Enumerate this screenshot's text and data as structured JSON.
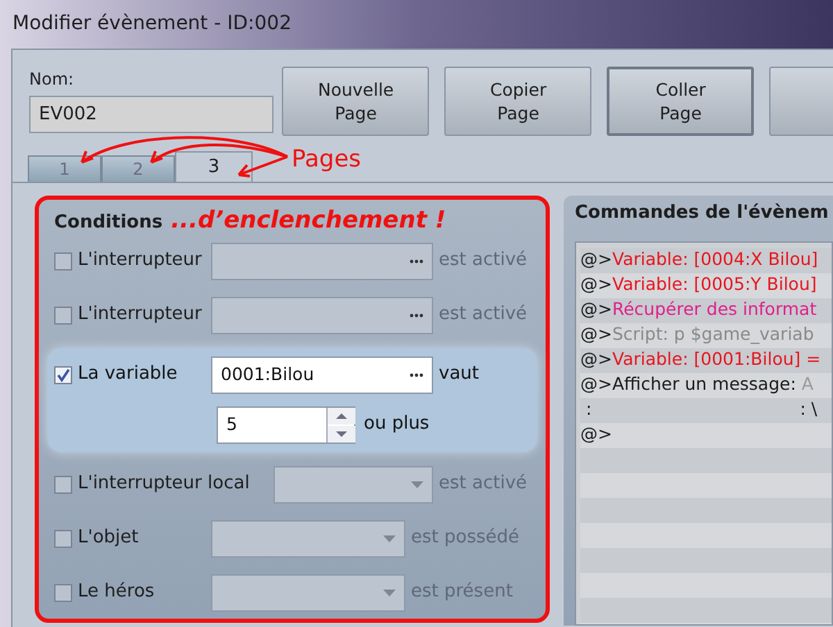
{
  "window": {
    "title": "Modifier évènement - ID:002"
  },
  "name_field": {
    "label": "Nom:",
    "value": "EV002"
  },
  "buttons": [
    {
      "label": "Nouvelle\nPage",
      "pressed": false
    },
    {
      "label": "Copier\nPage",
      "pressed": false
    },
    {
      "label": "Coller\nPage",
      "pressed": true
    },
    {
      "pressed": false
    }
  ],
  "tabs": [
    {
      "label": "1",
      "selected": false
    },
    {
      "label": "2",
      "selected": false
    },
    {
      "label": "3",
      "selected": true
    }
  ],
  "annotation": {
    "label": "Pages"
  },
  "conditions": {
    "title": "Conditions",
    "annotation": "...d’enclenchement !",
    "rows": [
      {
        "kind": "picker",
        "label": "L'interrupteur",
        "checked": false,
        "suffix": "est activé"
      },
      {
        "kind": "picker",
        "label": "L'interrupteur",
        "checked": false,
        "suffix": "est activé"
      },
      {
        "kind": "variable",
        "label": "La variable",
        "checked": true,
        "value": "0001:Bilou",
        "suffix": "vaut",
        "number": "5",
        "number_suffix": "ou plus"
      },
      {
        "kind": "dropdown_wide",
        "label": "L'interrupteur local",
        "checked": false,
        "suffix": "est activé"
      },
      {
        "kind": "dropdown",
        "label": "L'objet",
        "checked": false,
        "suffix": "est possédé"
      },
      {
        "kind": "dropdown",
        "label": "Le héros",
        "checked": false,
        "suffix": "est présent"
      }
    ]
  },
  "commands": {
    "title": "Commandes de l'évènem",
    "lines": [
      {
        "prefix": "@>",
        "segments": [
          {
            "text": "Variable: [0004:X Bilou]",
            "color": "#e8141e"
          }
        ]
      },
      {
        "prefix": "@>",
        "segments": [
          {
            "text": "Variable: [0005:Y Bilou]",
            "color": "#e8141e"
          }
        ]
      },
      {
        "prefix": "@>",
        "segments": [
          {
            "text": "Récupérer des informat",
            "color": "#e0208c"
          }
        ]
      },
      {
        "prefix": "@>",
        "segments": [
          {
            "text": "Script: p $game_variab",
            "color": "#8a8a8a"
          }
        ]
      },
      {
        "prefix": "@>",
        "segments": [
          {
            "text": "Variable: [0001:Bilou] =",
            "color": "#e8141e"
          }
        ]
      },
      {
        "prefix": "@>",
        "segments": [
          {
            "text": "Afficher un message: ",
            "color": "#1a1a1a"
          },
          {
            "text": "A",
            "color": "#9a9a9a"
          }
        ]
      },
      {
        "prefix": " :",
        "segments": [
          {
            "text": ": \\",
            "color": "#1a1a1a"
          }
        ]
      },
      {
        "prefix": "@>"
      }
    ]
  }
}
